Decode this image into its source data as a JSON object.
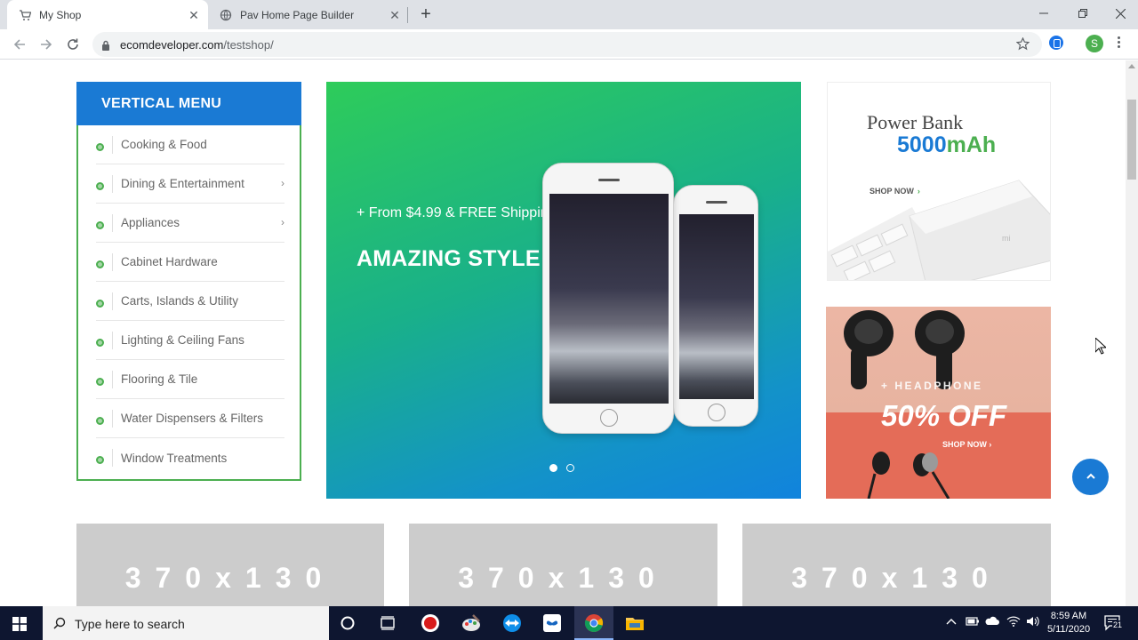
{
  "browser": {
    "tabs": [
      {
        "title": "My Shop"
      },
      {
        "title": "Pav Home Page Builder"
      }
    ],
    "url": {
      "host": "ecomdeveloper.com",
      "path": "/testshop/"
    },
    "profile_initial": "S"
  },
  "vertical_menu": {
    "title": "VERTICAL MENU",
    "items": [
      {
        "label": "Cooking & Food",
        "has_submenu": false
      },
      {
        "label": "Dining & Entertainment",
        "has_submenu": true
      },
      {
        "label": "Appliances",
        "has_submenu": true
      },
      {
        "label": "Cabinet Hardware",
        "has_submenu": false
      },
      {
        "label": "Carts, Islands & Utility",
        "has_submenu": false
      },
      {
        "label": "Lighting & Ceiling Fans",
        "has_submenu": false
      },
      {
        "label": "Flooring & Tile",
        "has_submenu": false
      },
      {
        "label": "Water Dispensers & Filters",
        "has_submenu": false
      },
      {
        "label": "Window Treatments",
        "has_submenu": false
      }
    ]
  },
  "hero": {
    "promo": "+ From $4.99 & FREE Shipping",
    "title": "AMAZING STYLE",
    "active_slide": 1,
    "slide_count": 2
  },
  "powerbank_banner": {
    "line1": "Power Bank",
    "capacity_number": "5000",
    "capacity_unit": "mAh",
    "cta": "SHOP NOW",
    "cta_arrow": "›"
  },
  "headphone_banner": {
    "tag": "+ HEADPHONE",
    "discount": "50% OFF",
    "cta": "SHOP NOW",
    "cta_arrow": "›"
  },
  "placeholders": [
    {
      "label": "370x130"
    },
    {
      "label": "370x130"
    },
    {
      "label": "370x130"
    }
  ],
  "taskbar": {
    "search_placeholder": "Type here to search",
    "time": "8:59 AM",
    "date": "5/11/2020",
    "notification_count": "21"
  },
  "colors": {
    "menu_header": "#1a7ad4",
    "menu_border": "#4caf50",
    "power_blue": "#1a7ad4",
    "power_green": "#4caf50",
    "headphone_bottom": "#e46c58"
  }
}
